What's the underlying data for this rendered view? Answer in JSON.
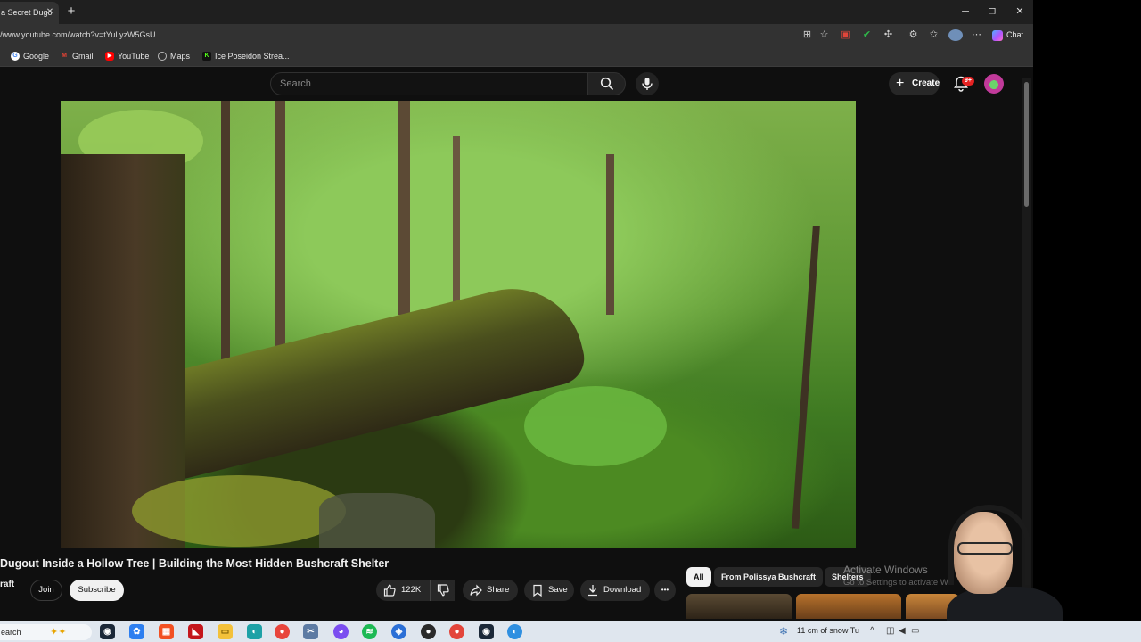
{
  "browser": {
    "tab_title": "a Secret Dugo",
    "tab_close": "✕",
    "new_tab": "+",
    "window_controls": [
      "─",
      "❐",
      "✕"
    ],
    "url": "/www.youtube.com/watch?v=tYuLyzW5GsU",
    "chat_label": "Chat",
    "bookmarks": [
      {
        "label": "Google",
        "icon": "google-icon",
        "color": "#4285f4",
        "glyph": "G"
      },
      {
        "label": "Gmail",
        "icon": "gmail-icon",
        "color": "#ea4335",
        "glyph": "M"
      },
      {
        "label": "YouTube",
        "icon": "youtube-icon",
        "color": "#ff0000",
        "glyph": "▶"
      },
      {
        "label": "Maps",
        "icon": "globe-icon",
        "color": "#8a8a8a",
        "glyph": "◎"
      },
      {
        "label": "Ice Poseidon Strea...",
        "icon": "kick-icon",
        "color": "#53fc18",
        "glyph": "K"
      }
    ]
  },
  "youtube": {
    "search_placeholder": "Search",
    "create_label": "Create",
    "notification_badge": "9+",
    "video_title": "Dugout Inside a Hollow Tree | Building the Most Hidden Bushcraft Shelter",
    "channel_name": "raft",
    "join_label": "Join",
    "subscribe_label": "Subscribe",
    "likes": "122K",
    "share_label": "Share",
    "save_label": "Save",
    "download_label": "Download",
    "more_label": "•••",
    "chips": [
      "All",
      "From Polissya Bushcraft",
      "Shelters"
    ]
  },
  "overlay": {
    "activate_title": "Activate Windows",
    "activate_sub": "Go to Settings to activate W"
  },
  "taskbar": {
    "search_text": "earch",
    "weather": "11 cm of snow Tu",
    "tray_chevron": "^"
  },
  "colors": {
    "youtube_bg": "#0f0f0f",
    "notification_red": "#e52222",
    "subscribe_bg": "#f1f1f1",
    "taskbar_bg": "#dfe6ee"
  }
}
